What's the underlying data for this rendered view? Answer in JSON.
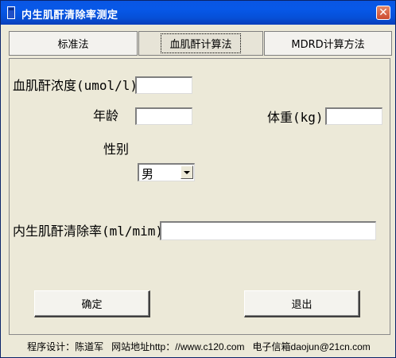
{
  "window": {
    "title": "内生肌酐清除率测定",
    "close_symbol": "✕"
  },
  "tabs": [
    {
      "label": "标准法"
    },
    {
      "label": "血肌酐计算法"
    },
    {
      "label": "MDRD计算方法"
    }
  ],
  "form": {
    "creatinine_label": "血肌酐浓度(umol/l)",
    "creatinine_value": "",
    "age_label": "年龄",
    "age_value": "",
    "weight_label": "体重(kg)",
    "weight_value": "",
    "sex_label": "性别",
    "sex_value": "男",
    "clearance_label": "内生肌酐清除率(ml/mim)",
    "clearance_value": ""
  },
  "buttons": {
    "ok": "确定",
    "exit": "退出"
  },
  "footer": "程序设计：陈道军   网站地址http：//www.c120.com   电子信箱daojun@21cn.com"
}
